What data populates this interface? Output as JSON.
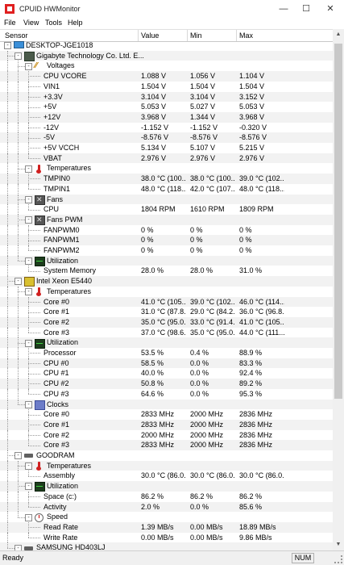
{
  "window": {
    "title": "CPUID HWMonitor",
    "minimize": "—",
    "maximize": "☐",
    "close": "✕"
  },
  "menu": [
    "File",
    "View",
    "Tools",
    "Help"
  ],
  "columns": [
    "Sensor",
    "Value",
    "Min",
    "Max"
  ],
  "tree": [
    {
      "d": 0,
      "label": "DESKTOP-JGE1018",
      "icon": "computer-icon",
      "exp": "-"
    },
    {
      "d": 1,
      "label": "Gigabyte Technology Co. Ltd. E...",
      "icon": "motherboard-icon",
      "exp": "-"
    },
    {
      "d": 2,
      "label": "Voltages",
      "icon": "voltage-icon",
      "exp": "-"
    },
    {
      "d": 3,
      "label": "CPU VCORE",
      "v": "1.088 V",
      "min": "1.056 V",
      "max": "1.104 V"
    },
    {
      "d": 3,
      "label": "VIN1",
      "v": "1.504 V",
      "min": "1.504 V",
      "max": "1.504 V"
    },
    {
      "d": 3,
      "label": "+3.3V",
      "v": "3.104 V",
      "min": "3.104 V",
      "max": "3.152 V"
    },
    {
      "d": 3,
      "label": "+5V",
      "v": "5.053 V",
      "min": "5.027 V",
      "max": "5.053 V"
    },
    {
      "d": 3,
      "label": "+12V",
      "v": "3.968 V",
      "min": "1.344 V",
      "max": "3.968 V"
    },
    {
      "d": 3,
      "label": "-12V",
      "v": "-1.152 V",
      "min": "-1.152 V",
      "max": "-0.320 V"
    },
    {
      "d": 3,
      "label": "-5V",
      "v": "-8.576 V",
      "min": "-8.576 V",
      "max": "-8.576 V"
    },
    {
      "d": 3,
      "label": "+5V VCCH",
      "v": "5.134 V",
      "min": "5.107 V",
      "max": "5.215 V"
    },
    {
      "d": 3,
      "label": "VBAT",
      "v": "2.976 V",
      "min": "2.976 V",
      "max": "2.976 V"
    },
    {
      "d": 2,
      "label": "Temperatures",
      "icon": "thermometer-icon",
      "exp": "-"
    },
    {
      "d": 3,
      "label": "TMPIN0",
      "v": "38.0 °C (100....",
      "min": "38.0 °C (100....",
      "max": "39.0 °C (102...."
    },
    {
      "d": 3,
      "label": "TMPIN1",
      "v": "48.0 °C (118....",
      "min": "42.0 °C (107....",
      "max": "48.0 °C (118...."
    },
    {
      "d": 2,
      "label": "Fans",
      "icon": "fan-icon",
      "exp": "-"
    },
    {
      "d": 3,
      "label": "CPU",
      "v": "1804 RPM",
      "min": "1610 RPM",
      "max": "1809 RPM"
    },
    {
      "d": 2,
      "label": "Fans PWM",
      "icon": "fan-icon",
      "exp": "-"
    },
    {
      "d": 3,
      "label": "FANPWM0",
      "v": "0 %",
      "min": "0 %",
      "max": "0 %"
    },
    {
      "d": 3,
      "label": "FANPWM1",
      "v": "0 %",
      "min": "0 %",
      "max": "0 %"
    },
    {
      "d": 3,
      "label": "FANPWM2",
      "v": "0 %",
      "min": "0 %",
      "max": "0 %"
    },
    {
      "d": 2,
      "label": "Utilization",
      "icon": "utilization-icon",
      "exp": "-"
    },
    {
      "d": 3,
      "label": "System Memory",
      "v": "28.0 %",
      "min": "28.0 %",
      "max": "31.0 %"
    },
    {
      "d": 1,
      "label": "Intel Xeon E5440",
      "icon": "cpu-icon",
      "exp": "-"
    },
    {
      "d": 2,
      "label": "Temperatures",
      "icon": "thermometer-icon",
      "exp": "-"
    },
    {
      "d": 3,
      "label": "Core #0",
      "v": "41.0 °C (105....",
      "min": "39.0 °C (102....",
      "max": "46.0 °C (114...."
    },
    {
      "d": 3,
      "label": "Core #1",
      "v": "31.0 °C (87.8...",
      "min": "29.0 °C (84.2...",
      "max": "36.0 °C (96.8..."
    },
    {
      "d": 3,
      "label": "Core #2",
      "v": "35.0 °C (95.0...",
      "min": "33.0 °C (91.4...",
      "max": "41.0 °C (105...."
    },
    {
      "d": 3,
      "label": "Core #3",
      "v": "37.0 °C (98.6...",
      "min": "35.0 °C (95.0...",
      "max": "44.0 °C (111...."
    },
    {
      "d": 2,
      "label": "Utilization",
      "icon": "utilization-icon",
      "exp": "-"
    },
    {
      "d": 3,
      "label": "Processor",
      "v": "53.5 %",
      "min": "0.4 %",
      "max": "88.9 %"
    },
    {
      "d": 3,
      "label": "CPU #0",
      "v": "58.5 %",
      "min": "0.0 %",
      "max": "83.3 %"
    },
    {
      "d": 3,
      "label": "CPU #1",
      "v": "40.0 %",
      "min": "0.0 %",
      "max": "92.4 %"
    },
    {
      "d": 3,
      "label": "CPU #2",
      "v": "50.8 %",
      "min": "0.0 %",
      "max": "89.2 %"
    },
    {
      "d": 3,
      "label": "CPU #3",
      "v": "64.6 %",
      "min": "0.0 %",
      "max": "95.3 %"
    },
    {
      "d": 2,
      "label": "Clocks",
      "icon": "clock-icon",
      "exp": "-"
    },
    {
      "d": 3,
      "label": "Core #0",
      "v": "2833 MHz",
      "min": "2000 MHz",
      "max": "2836 MHz"
    },
    {
      "d": 3,
      "label": "Core #1",
      "v": "2833 MHz",
      "min": "2000 MHz",
      "max": "2836 MHz"
    },
    {
      "d": 3,
      "label": "Core #2",
      "v": "2000 MHz",
      "min": "2000 MHz",
      "max": "2836 MHz"
    },
    {
      "d": 3,
      "label": "Core #3",
      "v": "2833 MHz",
      "min": "2000 MHz",
      "max": "2836 MHz"
    },
    {
      "d": 1,
      "label": "GOODRAM",
      "icon": "drive-icon",
      "exp": "-"
    },
    {
      "d": 2,
      "label": "Temperatures",
      "icon": "thermometer-icon",
      "exp": "-"
    },
    {
      "d": 3,
      "label": "Assembly",
      "v": "30.0 °C (86.0...",
      "min": "30.0 °C (86.0...",
      "max": "30.0 °C (86.0..."
    },
    {
      "d": 2,
      "label": "Utilization",
      "icon": "utilization-icon",
      "exp": "-"
    },
    {
      "d": 3,
      "label": "Space (c:)",
      "v": "86.2 %",
      "min": "86.2 %",
      "max": "86.2 %"
    },
    {
      "d": 3,
      "label": "Activity",
      "v": "2.0 %",
      "min": "0.0 %",
      "max": "85.6 %"
    },
    {
      "d": 2,
      "label": "Speed",
      "icon": "speed-icon",
      "exp": "-"
    },
    {
      "d": 3,
      "label": "Read Rate",
      "v": "1.39 MB/s",
      "min": "0.00 MB/s",
      "max": "18.89 MB/s"
    },
    {
      "d": 3,
      "label": "Write Rate",
      "v": "0.00 MB/s",
      "min": "0.00 MB/s",
      "max": "9.86 MB/s"
    },
    {
      "d": 1,
      "label": "SAMSUNG HD403LJ",
      "icon": "drive-icon",
      "exp": "-"
    }
  ],
  "status": {
    "text": "Ready",
    "num": "NUM"
  }
}
